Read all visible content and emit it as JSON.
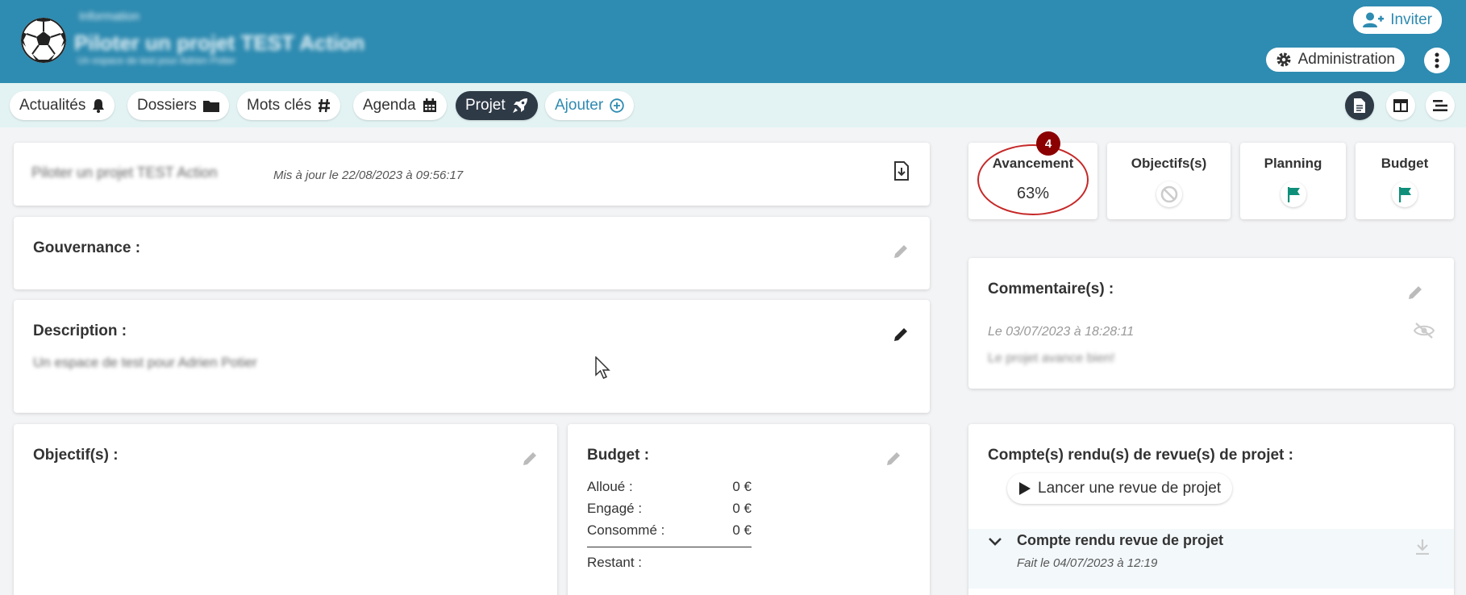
{
  "header": {
    "line1": "Information",
    "line2": "Piloter un projet TEST Action",
    "line3": "Un espace de test pour Adrien Potier",
    "invite_label": "Inviter",
    "admin_label": "Administration"
  },
  "tabs": [
    {
      "label": "Actualités",
      "icon": "bell-icon"
    },
    {
      "label": "Dossiers",
      "icon": "folder-icon"
    },
    {
      "label": "Mots clés",
      "icon": "hashtag-icon"
    },
    {
      "label": "Agenda",
      "icon": "calendar-icon"
    },
    {
      "label": "Projet",
      "icon": "rocket-icon",
      "active": true
    },
    {
      "label": "Ajouter",
      "icon": "plus-circle-icon"
    }
  ],
  "project": {
    "name": "Piloter un projet TEST Action",
    "updated": "Mis à jour le 22/08/2023 à 09:56:17"
  },
  "gouvernance": {
    "title": "Gouvernance :"
  },
  "description": {
    "title": "Description :",
    "text": "Un espace de test pour Adrien Potier"
  },
  "objectifs": {
    "title": "Objectif(s) :"
  },
  "budget": {
    "title": "Budget :",
    "rows": [
      {
        "label": "Alloué :",
        "value": "0 €"
      },
      {
        "label": "Engagé :",
        "value": "0 €"
      },
      {
        "label": "Consommé :",
        "value": "0 €"
      }
    ],
    "remaining_label": "Restant :"
  },
  "kpis": {
    "avancement_label": "Avancement",
    "avancement_value": "63%",
    "badge": "4",
    "objectifs_label": "Objectifs(s)",
    "planning_label": "Planning",
    "budget_label": "Budget"
  },
  "comments": {
    "title": "Commentaire(s) :",
    "date": "Le 03/07/2023 à 18:28:11",
    "text": "Le projet avance bien!"
  },
  "reviews": {
    "title": "Compte(s) rendu(s) de revue(s) de projet :",
    "launch_label": "Lancer une revue de projet",
    "item_title": "Compte rendu revue de projet",
    "item_date": "Fait le 04/07/2023 à 12:19"
  },
  "colors": {
    "header": "#2e8bb1",
    "tabs_bg": "#e3f3f3",
    "active_tab": "#2f3a47",
    "flag_green": "#0f8f7a",
    "highlight_red": "#c62828"
  }
}
